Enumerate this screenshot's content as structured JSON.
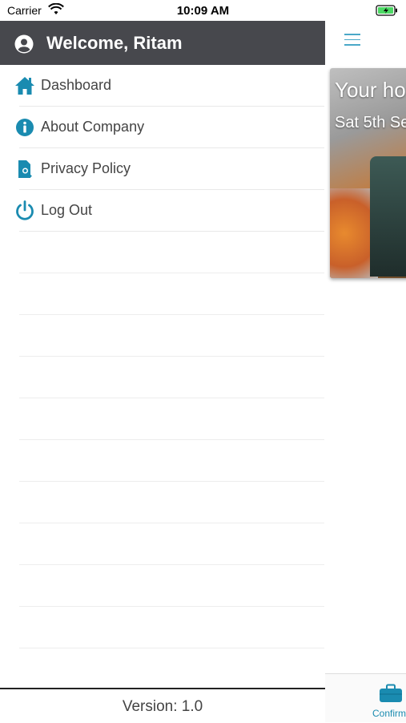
{
  "status_bar": {
    "carrier": "Carrier",
    "time": "10:09 AM"
  },
  "drawer": {
    "welcome": "Welcome, Ritam",
    "items": [
      {
        "label": "Dashboard",
        "icon": "home-icon"
      },
      {
        "label": "About Company",
        "icon": "info-icon"
      },
      {
        "label": "Privacy Policy",
        "icon": "document-icon"
      },
      {
        "label": "Log Out",
        "icon": "power-icon"
      }
    ],
    "version_label": "Version:  1.0"
  },
  "main": {
    "card_title": "Your hol",
    "card_date": "Sat 5th Se",
    "tab_label": "Confirm"
  },
  "colors": {
    "accent": "#1a8bb0",
    "header_bg": "#47484d"
  }
}
